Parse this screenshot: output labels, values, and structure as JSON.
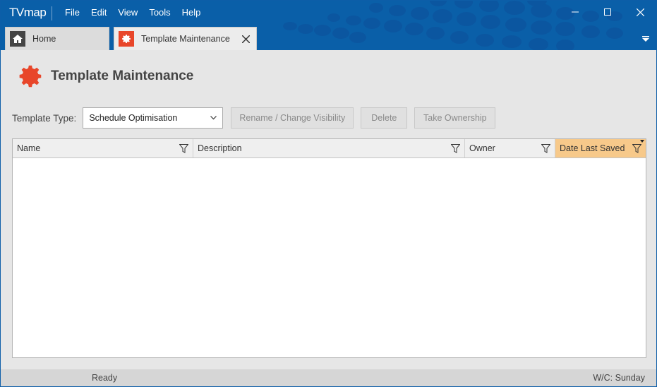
{
  "app": {
    "logo": "TVmap",
    "menu": [
      "File",
      "Edit",
      "View",
      "Tools",
      "Help"
    ]
  },
  "window_controls": {
    "minimize": "minimize-icon",
    "maximize": "maximize-icon",
    "close": "close-icon"
  },
  "tabs": [
    {
      "label": "Home",
      "icon": "home-icon",
      "active": false
    },
    {
      "label": "Template Maintenance",
      "icon": "gear-icon",
      "active": true,
      "closable": true
    }
  ],
  "page": {
    "title": "Template Maintenance",
    "icon": "gear-icon"
  },
  "toolbar": {
    "template_type_label": "Template Type:",
    "template_type_value": "Schedule Optimisation",
    "rename_label": "Rename / Change Visibility",
    "delete_label": "Delete",
    "take_ownership_label": "Take Ownership"
  },
  "grid": {
    "columns": [
      "Name",
      "Description",
      "Owner",
      "Date Last Saved"
    ],
    "rows": []
  },
  "status": {
    "text": "Ready",
    "right": "W/C: Sunday"
  },
  "colors": {
    "titlebar": "#0a5fa8",
    "accent": "#e8462a",
    "highlight_column": "#f7c98a"
  }
}
